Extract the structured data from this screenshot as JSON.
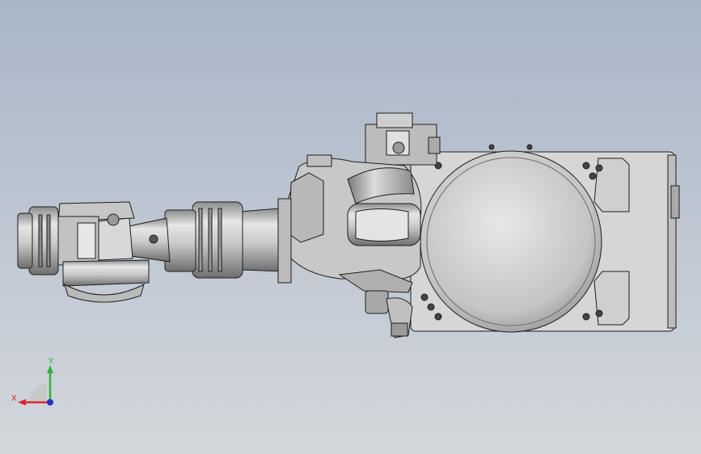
{
  "viewport": {
    "background_top": "#a9b6c8",
    "background_bottom": "#d3d7dc"
  },
  "model": {
    "body_color": "#d2d2d2",
    "shade_color": "#9a9a9a",
    "edge_color": "#1e1e1e"
  },
  "triad": {
    "x_label": "X",
    "y_label": "Y",
    "x_color": "#d8262a",
    "y_color": "#2db43a",
    "z_color": "#2233cc"
  }
}
